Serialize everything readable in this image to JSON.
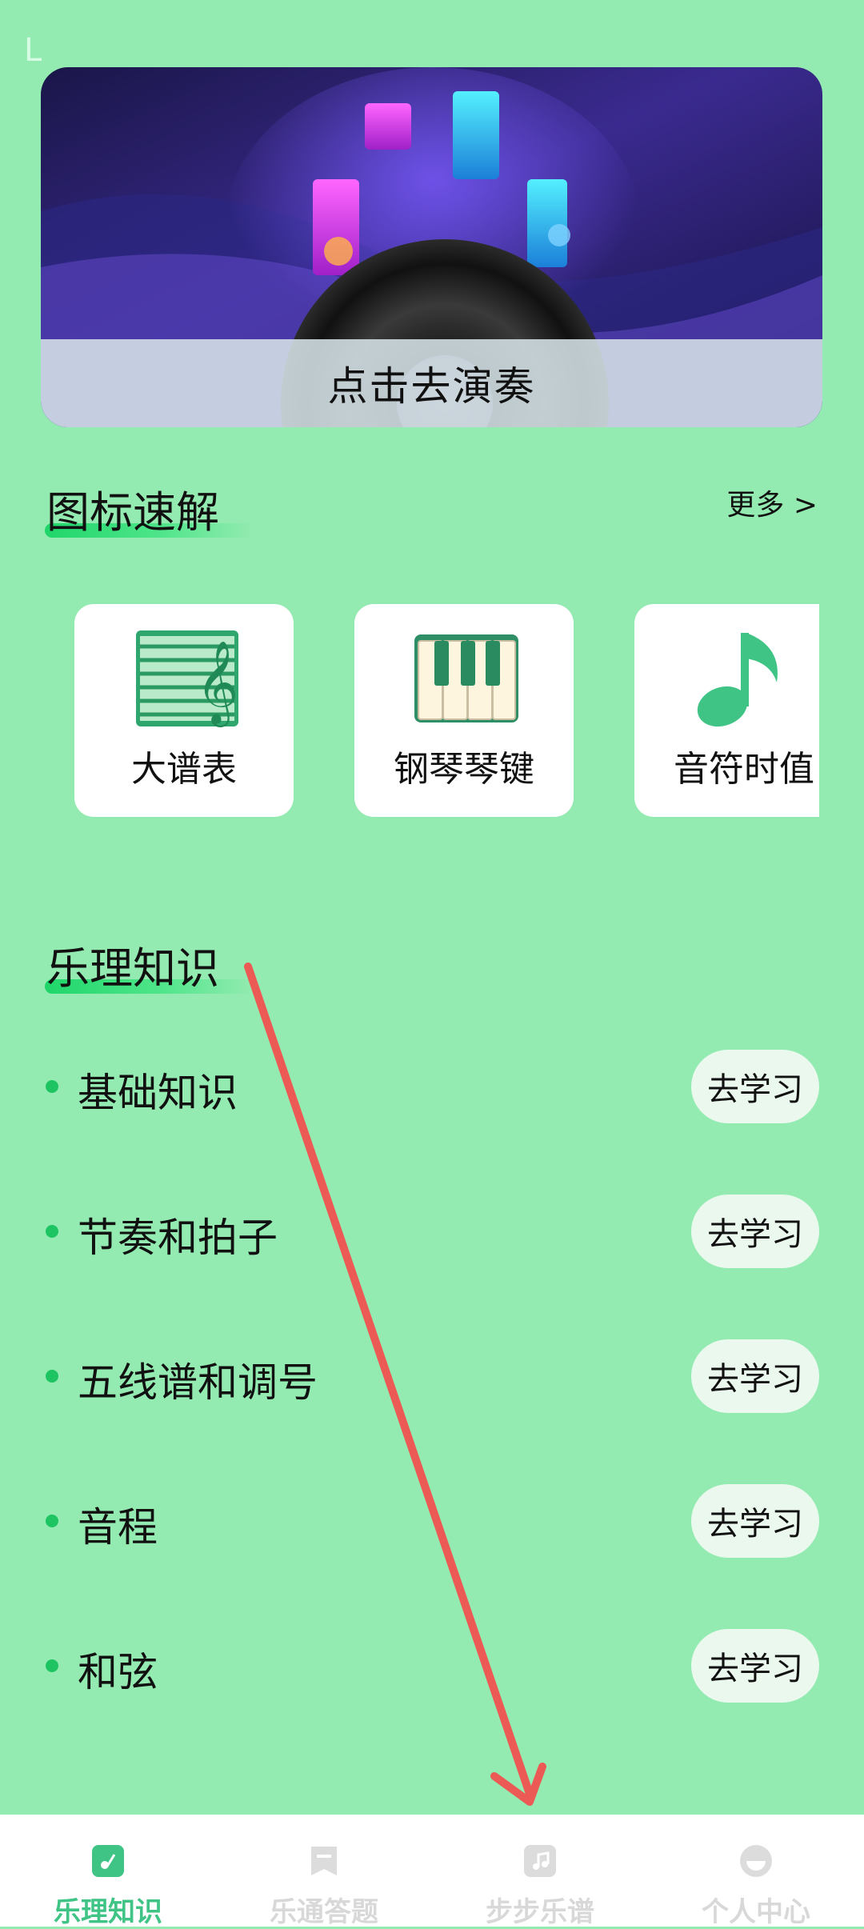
{
  "status_bar": {
    "mark": "L"
  },
  "banner": {
    "cta": "点击去演奏"
  },
  "icon_section": {
    "title": "图标速解",
    "more": "更多 >",
    "cards": [
      {
        "label": "大谱表",
        "icon": "grand-staff-icon"
      },
      {
        "label": "钢琴琴键",
        "icon": "piano-keys-icon"
      },
      {
        "label": "音符时值",
        "icon": "music-note-icon"
      }
    ]
  },
  "theory_section": {
    "title": "乐理知识",
    "items": [
      {
        "label": "基础知识",
        "button": "去学习"
      },
      {
        "label": "节奏和拍子",
        "button": "去学习"
      },
      {
        "label": "五线谱和调号",
        "button": "去学习"
      },
      {
        "label": "音程",
        "button": "去学习"
      },
      {
        "label": "和弦",
        "button": "去学习"
      }
    ]
  },
  "bottom_nav": {
    "items": [
      {
        "label": "乐理知识",
        "icon": "music-theory-icon",
        "active": true
      },
      {
        "label": "乐通答题",
        "icon": "bookmark-quiz-icon",
        "active": false
      },
      {
        "label": "步步乐谱",
        "icon": "sheet-music-icon",
        "active": false
      },
      {
        "label": "个人中心",
        "icon": "profile-icon",
        "active": false
      }
    ]
  },
  "colors": {
    "background": "#94ebb1",
    "accent_green": "#1fd66a",
    "active_nav": "#3fc486",
    "annotation_arrow": "#ec5a55"
  }
}
